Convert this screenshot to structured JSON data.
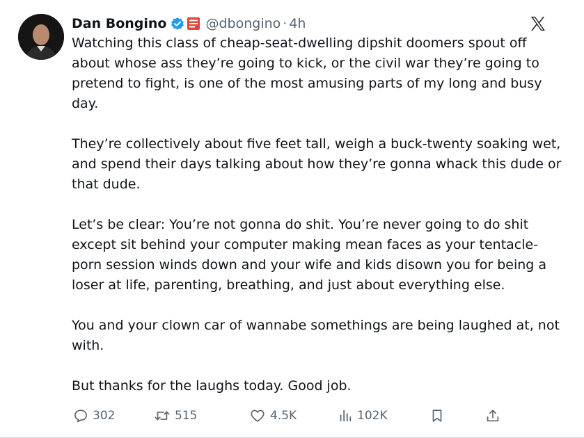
{
  "tweet": {
    "author_name": "Dan Bongino",
    "handle": "@dbongino",
    "separator": "·",
    "time": "4h",
    "paragraphs": [
      "Watching this class of cheap-seat-dwelling dipshit doomers spout off about whose ass they’re going to kick, or the civil war they’re going to pretend to fight, is one of the most amusing parts of my long and busy day.",
      "They’re collectively about five feet tall, weigh a buck-twenty soaking wet, and spend their days talking about how they’re gonna whack this dude or that dude.",
      "Let’s be clear: You’re not gonna do shit. You’re never going to do shit except sit behind your computer making mean faces as your tentacle-porn session winds down and your wife and kids disown you for being a loser at life, parenting, breathing, and just about everything else.",
      "You and your clown car of wannabe somethings are being laughed at, not with.",
      "But thanks for the laughs today. Good job."
    ]
  },
  "actions": {
    "replies": "302",
    "reposts": "515",
    "likes": "4.5K",
    "views": "102K"
  },
  "icons": {
    "verified": "verified-badge-icon",
    "org": "affiliate-badge-icon",
    "platform": "x-logo-icon",
    "reply": "reply-icon",
    "repost": "repost-icon",
    "like": "heart-icon",
    "views": "views-icon",
    "bookmark": "bookmark-icon",
    "share": "share-icon"
  },
  "colors": {
    "text": "#0f1419",
    "secondary": "#536471",
    "verified_blue": "#1d9bf0",
    "org_badge_red": "#e0463b"
  }
}
